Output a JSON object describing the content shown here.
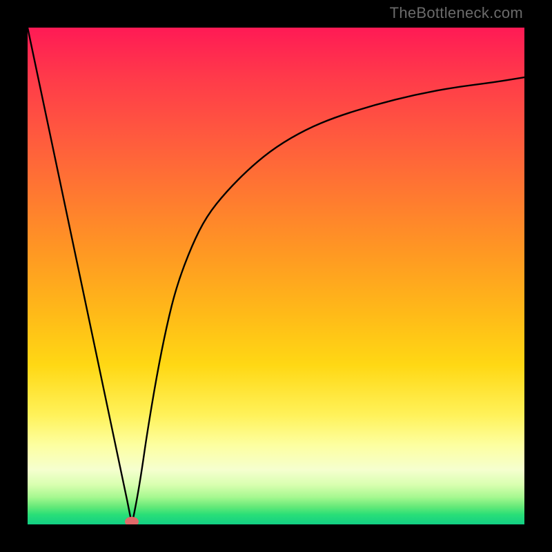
{
  "watermark": "TheBottleneck.com",
  "colors": {
    "frame": "#000000",
    "grad_top": "#ff1a55",
    "grad_mid1": "#ff9a22",
    "grad_mid2": "#fff25a",
    "grad_bottom": "#12cf84",
    "curve": "#000000",
    "marker": "#e06a6a"
  },
  "chart_data": {
    "type": "line",
    "title": "",
    "xlabel": "",
    "ylabel": "",
    "xlim": [
      0,
      100
    ],
    "ylim": [
      0,
      100
    ],
    "x": [
      0,
      2,
      4,
      6,
      8,
      10,
      12,
      14,
      16,
      18,
      20,
      21,
      22,
      23,
      24,
      26,
      28,
      30,
      33,
      36,
      40,
      45,
      50,
      56,
      62,
      70,
      78,
      86,
      94,
      100
    ],
    "y": [
      100,
      90.5,
      81,
      71.5,
      62,
      52.5,
      43,
      33.5,
      24,
      14.5,
      5,
      0,
      5,
      11,
      18,
      30,
      40,
      48,
      56,
      62,
      67,
      72,
      76,
      79.5,
      82,
      84.5,
      86.5,
      88,
      89,
      90
    ],
    "notch": {
      "x_percent": 21,
      "y_value": 0
    },
    "legend": [],
    "grid": false,
    "description": "Absolute-value-like curve descending linearly from top-left to a cusp near x≈21%, then rising with diminishing slope toward top-right; background heatmap gradient red→green indicates bottleneck severity (top red = worse, bottom green = optimal)."
  }
}
